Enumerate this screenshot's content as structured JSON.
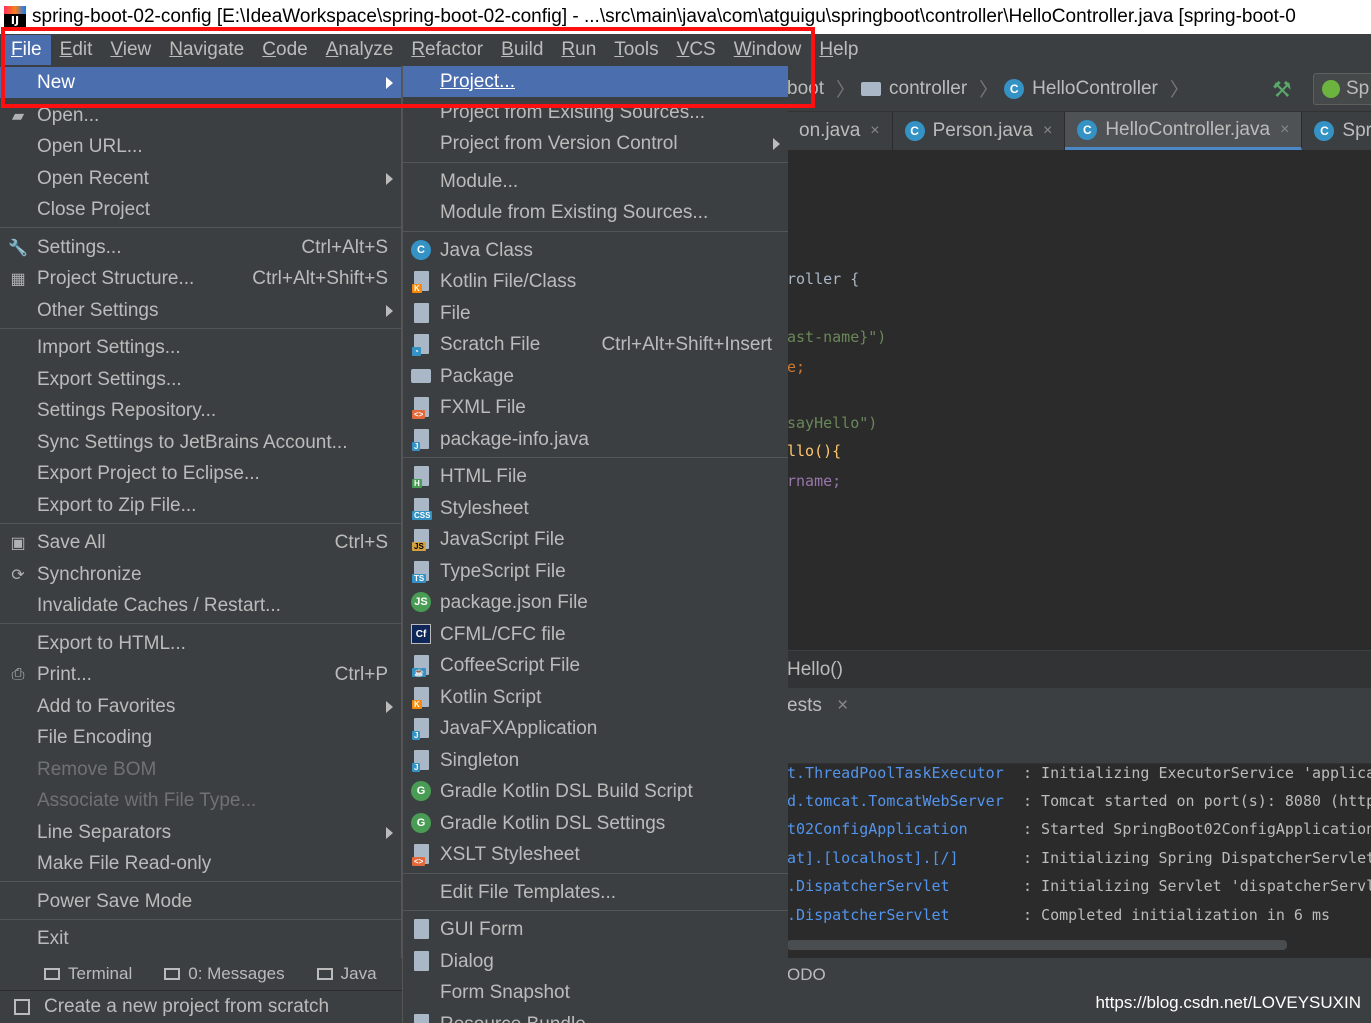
{
  "title_bar": {
    "app_icon": "IJ",
    "title": "spring-boot-02-config [E:\\IdeaWorkspace\\spring-boot-02-config] - ...\\src\\main\\java\\com\\atguigu\\springboot\\controller\\HelloController.java [spring-boot-0"
  },
  "menu_bar": {
    "items": [
      "File",
      "Edit",
      "View",
      "Navigate",
      "Code",
      "Analyze",
      "Refactor",
      "Build",
      "Run",
      "Tools",
      "VCS",
      "Window",
      "Help"
    ]
  },
  "navigation_bar": {
    "crumbs": [
      "boot",
      "controller",
      "HelloController"
    ],
    "run_config": "Sp"
  },
  "editor_tabs": [
    {
      "label": "on.java",
      "close": "×"
    },
    {
      "label": "Person.java",
      "close": "×",
      "icon": "C"
    },
    {
      "label": "HelloController.java",
      "close": "×",
      "icon": "C",
      "active": true
    },
    {
      "label": "Sprin",
      "icon": "C"
    }
  ],
  "editor": {
    "lines": [
      {
        "text": "roller {",
        "style": "kw"
      },
      {
        "text": "ast-name}\")",
        "style": "str"
      },
      {
        "text": "e;",
        "style": "orange"
      },
      {
        "text": "sayHello\")",
        "style": "str"
      },
      {
        "text": "llo(){",
        "style": "fn"
      },
      {
        "text": "rname;",
        "style": "fld"
      }
    ]
  },
  "structure_text": "Hello()",
  "run_tab": {
    "label": "ests",
    "close": "×"
  },
  "console": {
    "rows": [
      {
        "source": "t.ThreadPoolTaskExecutor",
        "message": ": Initializing ExecutorService 'applica"
      },
      {
        "source": "d.tomcat.TomcatWebServer",
        "message": ": Tomcat started on port(s): 8080 (http"
      },
      {
        "source": "t02ConfigApplication",
        "message": ": Started SpringBoot02ConfigApplication"
      },
      {
        "source": "at].[localhost].[/]",
        "message": ": Initializing Spring DispatcherServlet"
      },
      {
        "source": ".DispatcherServlet",
        "message": ": Initializing Servlet 'dispatcherServl"
      },
      {
        "source": ".DispatcherServlet",
        "message": ": Completed initialization in 6 ms"
      }
    ]
  },
  "todo_label": "ODO",
  "watermark": "https://blog.csdn.net/LOVEYSUXIN",
  "file_menu": {
    "items": [
      {
        "label": "New",
        "arrow": true,
        "highlighted": true
      },
      {
        "label": "Open...",
        "icon": "folder-icon"
      },
      {
        "label": "Open URL..."
      },
      {
        "label": "Open Recent",
        "arrow": true
      },
      {
        "label": "Close Project"
      },
      {
        "label": "Settings...",
        "shortcut": "Ctrl+Alt+S",
        "icon": "wrench-icon"
      },
      {
        "label": "Project Structure...",
        "shortcut": "Ctrl+Alt+Shift+S",
        "icon": "project-structure-icon"
      },
      {
        "label": "Other Settings",
        "arrow": true
      },
      {
        "label": "Import Settings..."
      },
      {
        "label": "Export Settings..."
      },
      {
        "label": "Settings Repository..."
      },
      {
        "label": "Sync Settings to JetBrains Account..."
      },
      {
        "label": "Export Project to Eclipse..."
      },
      {
        "label": "Export to Zip File..."
      },
      {
        "label": "Save All",
        "shortcut": "Ctrl+S",
        "icon": "save-icon"
      },
      {
        "label": "Synchronize",
        "icon": "sync-icon"
      },
      {
        "label": "Invalidate Caches / Restart..."
      },
      {
        "label": "Export to HTML..."
      },
      {
        "label": "Print...",
        "shortcut": "Ctrl+P",
        "icon": "print-icon"
      },
      {
        "label": "Add to Favorites",
        "arrow": true
      },
      {
        "label": "File Encoding"
      },
      {
        "label": "Remove BOM",
        "disabled": true
      },
      {
        "label": "Associate with File Type...",
        "disabled": true
      },
      {
        "label": "Line Separators",
        "arrow": true
      },
      {
        "label": "Make File Read-only"
      },
      {
        "label": "Power Save Mode"
      },
      {
        "label": "Exit"
      }
    ]
  },
  "new_submenu": {
    "items": [
      {
        "label": "Project...",
        "highlighted": true
      },
      {
        "label": "Project from Existing Sources..."
      },
      {
        "label": "Project from Version Control",
        "arrow": true
      },
      {
        "label": "Module..."
      },
      {
        "label": "Module from Existing Sources..."
      },
      {
        "label": "Java Class",
        "icon": "java-class-icon"
      },
      {
        "label": "Kotlin File/Class",
        "icon": "kotlin-file-icon"
      },
      {
        "label": "File",
        "icon": "file-icon"
      },
      {
        "label": "Scratch File",
        "shortcut": "Ctrl+Alt+Shift+Insert",
        "icon": "scratch-file-icon"
      },
      {
        "label": "Package",
        "icon": "package-icon"
      },
      {
        "label": "FXML File",
        "icon": "fxml-file-icon"
      },
      {
        "label": "package-info.java",
        "icon": "package-info-icon"
      },
      {
        "label": "HTML File",
        "icon": "html-file-icon"
      },
      {
        "label": "Stylesheet",
        "icon": "css-file-icon"
      },
      {
        "label": "JavaScript File",
        "icon": "js-file-icon"
      },
      {
        "label": "TypeScript File",
        "icon": "ts-file-icon"
      },
      {
        "label": "package.json File",
        "icon": "nodejs-icon"
      },
      {
        "label": "CFML/CFC file",
        "icon": "cfml-icon"
      },
      {
        "label": "CoffeeScript File",
        "icon": "coffeescript-icon"
      },
      {
        "label": "Kotlin Script",
        "icon": "kotlin-script-icon"
      },
      {
        "label": "JavaFXApplication",
        "icon": "javafx-icon"
      },
      {
        "label": "Singleton",
        "icon": "singleton-icon"
      },
      {
        "label": "Gradle Kotlin DSL Build Script",
        "icon": "gradle-icon"
      },
      {
        "label": "Gradle Kotlin DSL Settings",
        "icon": "gradle-icon"
      },
      {
        "label": "XSLT Stylesheet",
        "icon": "xslt-icon"
      },
      {
        "label": "Edit File Templates..."
      },
      {
        "label": "GUI Form",
        "icon": "gui-form-icon"
      },
      {
        "label": "Dialog",
        "icon": "dialog-icon"
      },
      {
        "label": "Form Snapshot"
      },
      {
        "label": "Resource Bundle",
        "icon": "resource-bundle-icon"
      }
    ]
  },
  "tool_windows": [
    {
      "label": "Terminal"
    },
    {
      "label": "0: Messages"
    },
    {
      "label": "Java"
    }
  ],
  "status_bar": {
    "text": "Create a new project from scratch"
  },
  "colors": {
    "menu_bg": "#3c3f41",
    "highlight": "#4b6eaf",
    "editor_bg": "#2b2b2b",
    "annotation_box": "#ff1010"
  }
}
